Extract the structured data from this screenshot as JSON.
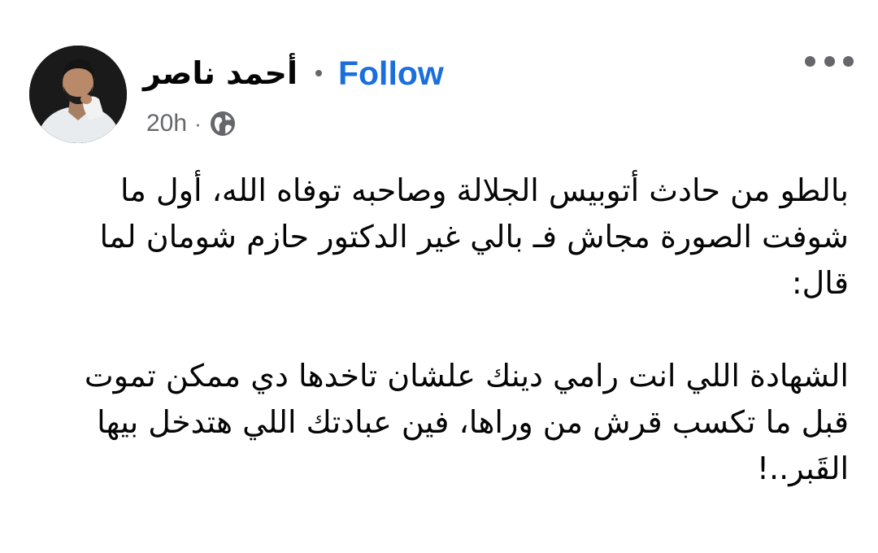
{
  "post": {
    "author_name": "أحمد ناصر",
    "follow_label": "Follow",
    "timestamp": "20h",
    "separator": "·",
    "privacy_icon": "globe-icon",
    "more_icon": "more-options-icon",
    "paragraphs": [
      {
        "lines": [
          "بالطو من حادث أتوبيس الجلالة وصاحبه توفاه الله، أول ما",
          "شوفت الصورة مجاش فـ بالي غير الدكتور حازم شومان لما",
          "قال:"
        ]
      },
      {
        "lines": [
          "الشهادة اللي انت رامي دينك علشان تاخدها دي ممكن تموت",
          "قبل ما تكسب قرش من وراها، فين عبادتك اللي هتدخل بيها",
          "القَبر..!"
        ]
      }
    ]
  },
  "colors": {
    "follow": "#1b6fdc",
    "secondary_text": "#65676b",
    "primary_text": "#050505",
    "background": "#ffffff"
  }
}
